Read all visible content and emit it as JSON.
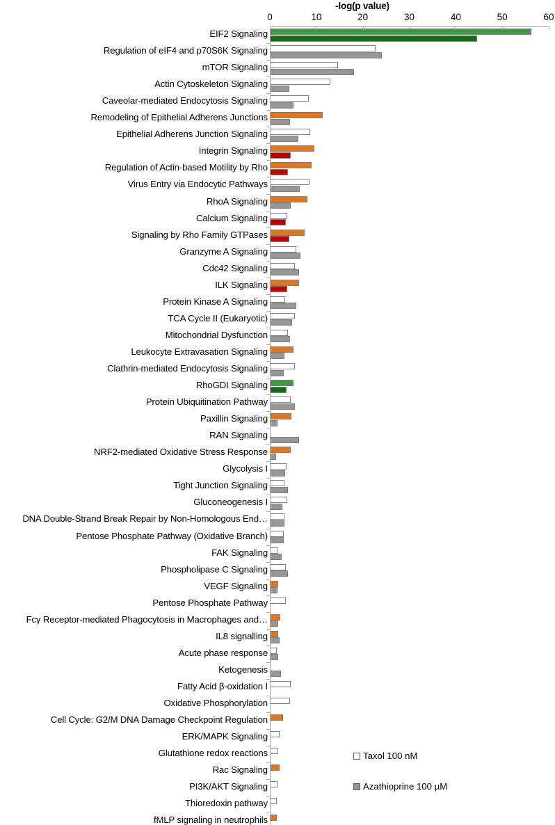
{
  "chart_data": {
    "type": "bar",
    "orientation": "horizontal",
    "title": "-log(p value)",
    "xlabel": "-log(p value)",
    "ylabel": "",
    "xlim": [
      0,
      60
    ],
    "xticks": [
      0,
      10,
      20,
      30,
      40,
      50,
      60
    ],
    "grid": false,
    "legend_position": "bottom-right",
    "colors": {
      "taxol_default": "#ffffff",
      "taxol_orange": "#e3761a",
      "taxol_green": "#3e9b3e",
      "azathioprine_default": "#969696",
      "azathioprine_red": "#c00000",
      "azathioprine_green": "#136b13",
      "bar_outline": "#808080",
      "axis": "#a6a6a6"
    },
    "series": [
      {
        "name": "Taxol 100 nM",
        "key": "taxol"
      },
      {
        "name": "Azathioprine 100 µM",
        "key": "azathioprine"
      }
    ],
    "categories": [
      "EIF2 Signaling",
      "Regulation of eIF4 and p70S6K Signaling",
      "mTOR Signaling",
      "Actin Cytoskeleton Signaling",
      "Caveolar-mediated Endocytosis Signaling",
      "Remodeling of Epithelial Adherens Junctions",
      "Epithelial Adherens Junction Signaling",
      "Integrin Signaling",
      "Regulation of Actin-based Motility by Rho",
      "Virus Entry via Endocytic Pathways",
      "RhoA Signaling",
      "Calcium Signaling",
      "Signaling by Rho Family GTPases",
      "Granzyme A Signaling",
      "Cdc42 Signaling",
      "ILK Signaling",
      "Protein Kinase A Signaling",
      "TCA Cycle II (Eukaryotic)",
      "Mitochondrial Dysfunction",
      "Leukocyte Extravasation Signaling",
      "Clathrin-mediated Endocytosis Signaling",
      "RhoGDI Signaling",
      "Protein Ubiquitination Pathway",
      "Paxillin Signaling",
      "RAN Signaling",
      "NRF2-mediated Oxidative Stress Response",
      "Glycolysis I",
      "Tight Junction Signaling",
      "Gluconeogenesis I",
      "DNA Double-Strand Break Repair by Non-Homologous End…",
      "Pentose Phosphate Pathway (Oxidative Branch)",
      "FAK Signaling",
      "Phospholipase C Signaling",
      "VEGF Signaling",
      "Pentose Phosphate Pathway",
      "Fcγ Receptor-mediated Phagocytosis in Macrophages and…",
      "IL8 signalling",
      "Acute phase response",
      "Ketogenesis",
      "Fatty Acid β-oxidation I",
      "Oxidative Phosphorylation",
      "Cell Cycle: G2/M DNA Damage Checkpoint Regulation",
      "ERK/MAPK Signaling",
      "Glutathione redox reactions",
      "Rac Signaling",
      "PI3K/AKT Signaling",
      "Thioredoxin pathway",
      "fMLP signaling in neutrophils"
    ],
    "values": {
      "taxol": [
        56.1,
        22.6,
        14.5,
        12.9,
        8.2,
        11.2,
        8.6,
        9.5,
        8.8,
        8.4,
        7.9,
        3.6,
        7.3,
        5.6,
        5.3,
        6.2,
        3.2,
        5.2,
        3.7,
        5.0,
        5.2,
        5.0,
        4.4,
        4.5,
        0.0,
        4.3,
        3.5,
        3.0,
        3.6,
        3.0,
        2.9,
        1.7,
        3.3,
        1.7,
        3.3,
        2.1,
        1.6,
        1.3,
        0.0,
        4.3,
        4.2,
        2.7,
        1.9,
        1.6,
        1.9,
        1.5,
        1.3,
        1.4
      ],
      "azathioprine": [
        44.5,
        24.0,
        17.9,
        4.0,
        5.0,
        4.2,
        6.0,
        4.4,
        3.7,
        6.3,
        4.4,
        3.3,
        4.0,
        6.4,
        6.2,
        3.6,
        5.6,
        4.6,
        4.2,
        3.0,
        2.9,
        3.5,
        5.2,
        1.5,
        6.2,
        1.2,
        3.1,
        3.8,
        2.6,
        3.0,
        2.9,
        2.4,
        3.7,
        1.5,
        0.0,
        1.7,
        2.0,
        1.6,
        2.3,
        0.0,
        0.0,
        0.0,
        0.0,
        0.0,
        0.0,
        0.0,
        0.0,
        0.0
      ]
    },
    "bar_colors": {
      "taxol": [
        "#3e9b3e",
        "#ffffff",
        "#ffffff",
        "#ffffff",
        "#ffffff",
        "#e3761a",
        "#ffffff",
        "#e3761a",
        "#e3761a",
        "#ffffff",
        "#e3761a",
        "#ffffff",
        "#e3761a",
        "#ffffff",
        "#ffffff",
        "#e3761a",
        "#ffffff",
        "#ffffff",
        "#ffffff",
        "#e3761a",
        "#ffffff",
        "#3e9b3e",
        "#ffffff",
        "#e3761a",
        "#ffffff",
        "#e3761a",
        "#ffffff",
        "#ffffff",
        "#ffffff",
        "#ffffff",
        "#ffffff",
        "#ffffff",
        "#ffffff",
        "#e3761a",
        "#ffffff",
        "#e3761a",
        "#e3761a",
        "#ffffff",
        "#ffffff",
        "#ffffff",
        "#ffffff",
        "#e3761a",
        "#ffffff",
        "#ffffff",
        "#e3761a",
        "#ffffff",
        "#ffffff",
        "#e3761a"
      ],
      "azathioprine": [
        "#136b13",
        "#969696",
        "#969696",
        "#969696",
        "#969696",
        "#969696",
        "#969696",
        "#c00000",
        "#c00000",
        "#969696",
        "#969696",
        "#c00000",
        "#c00000",
        "#969696",
        "#969696",
        "#c00000",
        "#969696",
        "#969696",
        "#969696",
        "#969696",
        "#969696",
        "#136b13",
        "#969696",
        "#969696",
        "#969696",
        "#969696",
        "#969696",
        "#969696",
        "#969696",
        "#969696",
        "#969696",
        "#969696",
        "#969696",
        "#969696",
        "#969696",
        "#969696",
        "#969696",
        "#969696",
        "#969696",
        "#969696",
        "#969696",
        "#969696",
        "#969696",
        "#969696",
        "#969696",
        "#969696",
        "#969696",
        "#969696"
      ]
    }
  },
  "legend": {
    "items": [
      {
        "label": "Taxol 100 nM",
        "swatch": "#ffffff"
      },
      {
        "label": "Azathioprine 100 µM",
        "swatch": "#969696"
      }
    ]
  }
}
